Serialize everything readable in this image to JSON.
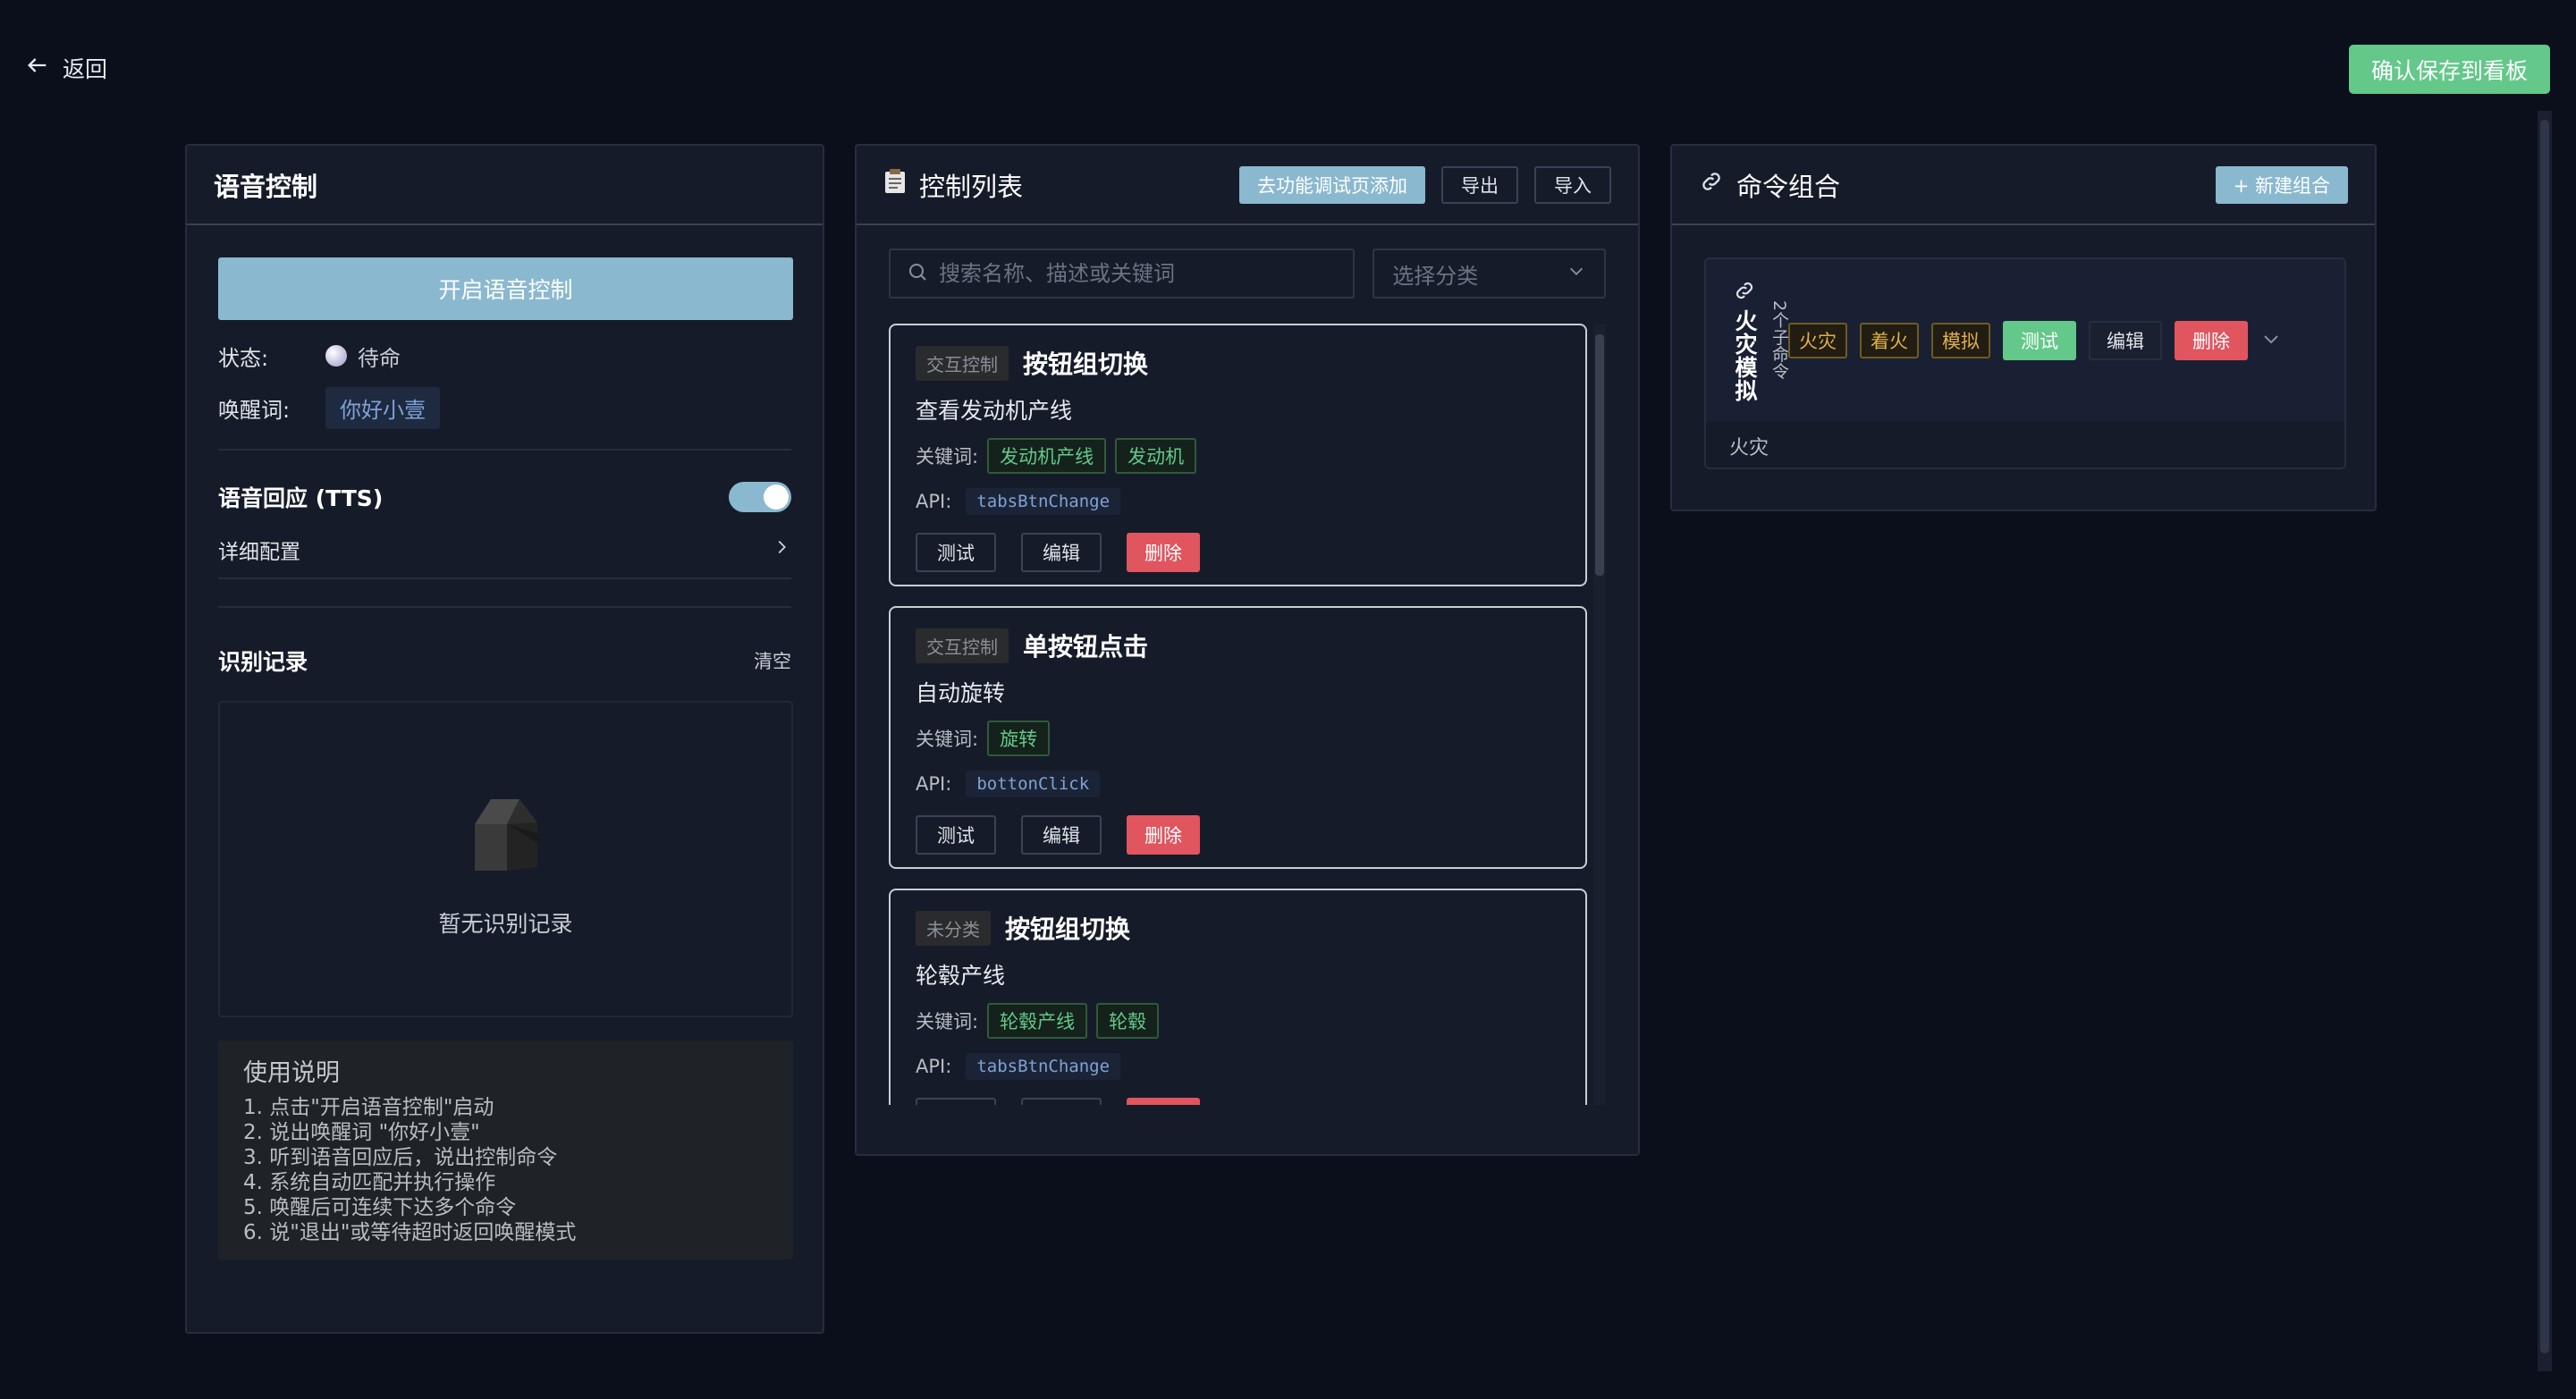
{
  "topbar": {
    "back_label": "返回",
    "save_label": "确认保存到看板"
  },
  "voice_panel": {
    "title": "语音控制",
    "start_button": "开启语音控制",
    "status_label": "状态:",
    "status_value": "待命",
    "wake_label": "唤醒词:",
    "wake_value": "你好小壹",
    "tts_label": "语音回应 (TTS)",
    "tts_enabled": true,
    "detail_label": "详细配置",
    "records_title": "识别记录",
    "records_clear": "清空",
    "records_empty": "暂无识别记录",
    "guide_title": "使用说明",
    "guide_lines": [
      "1. 点击\"开启语音控制\"启动",
      "2. 说出唤醒词 \"你好小壹\"",
      "3. 听到语音回应后，说出控制命令",
      "4. 系统自动匹配并执行操作",
      "5. 唤醒后可连续下达多个命令",
      "6. 说\"退出\"或等待超时返回唤醒模式"
    ]
  },
  "list_panel": {
    "title": "控制列表",
    "add_button": "去功能调试页添加",
    "export_button": "导出",
    "import_button": "导入",
    "search_placeholder": "搜索名称、描述或关键词",
    "category_placeholder": "选择分类",
    "keyword_label": "关键词:",
    "api_label": "API:",
    "test_label": "测试",
    "edit_label": "编辑",
    "delete_label": "删除",
    "items": [
      {
        "category": "交互控制",
        "title": "按钮组切换",
        "desc": "查看发动机产线",
        "keywords": [
          "发动机产线",
          "发动机"
        ],
        "api": "tabsBtnChange"
      },
      {
        "category": "交互控制",
        "title": "单按钮点击",
        "desc": "自动旋转",
        "keywords": [
          "旋转"
        ],
        "api": "bottonClick"
      },
      {
        "category": "未分类",
        "title": "按钮组切换",
        "desc": "轮毂产线",
        "keywords": [
          "轮毂产线",
          "轮毂"
        ],
        "api": "tabsBtnChange"
      }
    ]
  },
  "combo_panel": {
    "title": "命令组合",
    "new_button": "+ 新建组合",
    "combos": [
      {
        "name": "火灾模拟",
        "count": "2个子命令",
        "tags": [
          "火灾",
          "着火",
          "模拟"
        ],
        "test": "测试",
        "edit": "编辑",
        "delete": "删除",
        "footer": "火灾"
      }
    ]
  },
  "colors": {
    "accent": "#8ab8cf",
    "success": "#63c88a",
    "danger": "#e0555e",
    "background": "#0b0f1c",
    "panel": "#161b2a"
  },
  "icons": {
    "back": "arrow-left-icon",
    "list": "clipboard-icon",
    "combo": "link-icon",
    "search": "search-icon",
    "chevron": "chevron-down-icon",
    "empty": "empty-box-icon"
  }
}
